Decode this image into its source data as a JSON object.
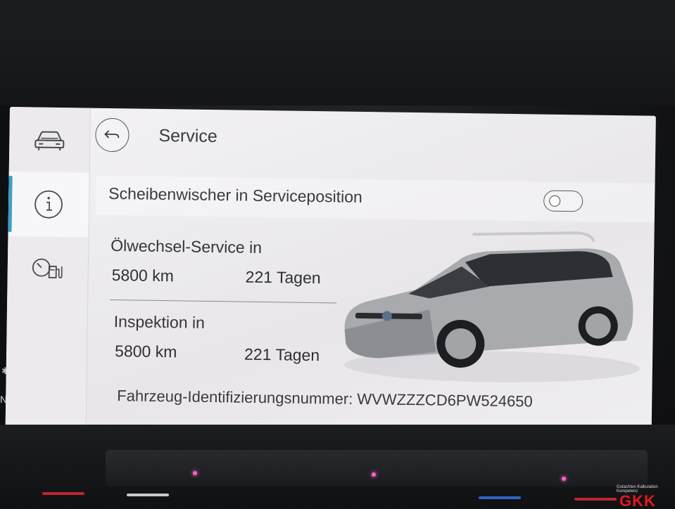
{
  "screen": {
    "title": "Service",
    "wiper_label": "Scheibenwischer in Serviceposition",
    "wiper_toggle_on": false,
    "oil_service": {
      "label": "Ölwechsel-Service in",
      "km": "5800 km",
      "days": "221 Tagen"
    },
    "inspection": {
      "label": "Inspektion in",
      "km": "5800 km",
      "days": "221 Tagen"
    },
    "vin_text": "Fahrzeug-Identifizierungsnummer: WVWZZZCD6PW524650"
  },
  "sidebar": {
    "items": [
      {
        "icon": "car-front-icon",
        "active": false
      },
      {
        "icon": "info-icon",
        "active": true
      },
      {
        "icon": "fuel-gauge-icon",
        "active": false
      }
    ]
  },
  "edge_text": "NC",
  "watermark": {
    "text": "GKK",
    "sub": "Gutachten Kalkulation Kompetenz"
  },
  "colors": {
    "accent": "#3aa0c9",
    "screen_bg": "#eeedf0",
    "led": "#ff5fc8",
    "logo": "#e4171e"
  }
}
